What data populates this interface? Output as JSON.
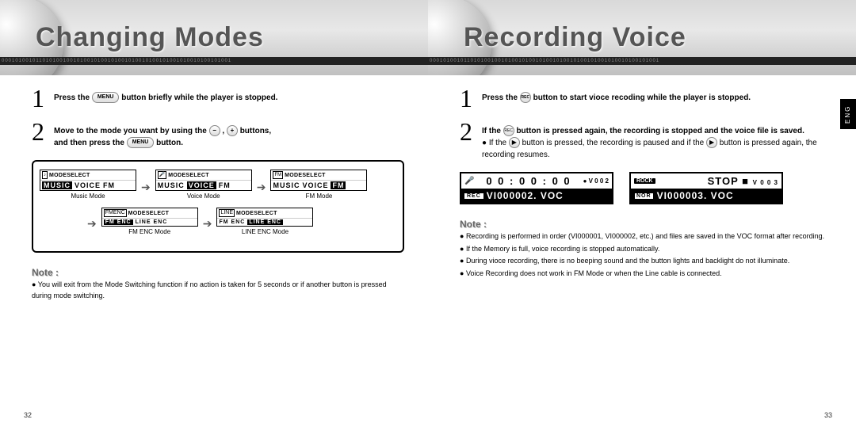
{
  "left": {
    "title": "Changing Modes",
    "binary": "0001010010110101001001010010100101001010010100101001010010100101001",
    "step1": {
      "text_a": "Press the",
      "btn": "MENU",
      "text_b": "button briefly while the player is stopped."
    },
    "step2": {
      "text_a": "Move to the mode you want by using the",
      "minus": "−",
      "plus": "+",
      "text_b": "buttons,",
      "text_c": "and then press the",
      "btn": "MENU",
      "text_d": "button."
    },
    "modeselect": "MODESELECT",
    "modes": {
      "music": {
        "opts": [
          "MUSIC",
          "VOICE",
          "FM"
        ],
        "sel": 0,
        "caption": "Music Mode",
        "icon": "♪"
      },
      "voice": {
        "opts": [
          "MUSIC",
          "VOICE",
          "FM"
        ],
        "sel": 1,
        "caption": "Voice Mode",
        "icon": "🎤"
      },
      "fm": {
        "opts": [
          "MUSIC",
          "VOICE",
          "FM"
        ],
        "sel": 2,
        "caption": "FM Mode",
        "icon": "FM"
      },
      "fmenc": {
        "opts": [
          "FM ENC",
          "LINE ENC"
        ],
        "sel": 0,
        "caption": "FM ENC Mode",
        "icon": "FMENC"
      },
      "lineenc": {
        "opts": [
          "FM ENC",
          "LINE ENC"
        ],
        "sel": 1,
        "caption": "LINE ENC Mode",
        "icon": "LINE"
      }
    },
    "note_label": "Note :",
    "note_text": "You will exit from the Mode Switching function if no action is taken for 5 seconds or if another button is pressed during mode switching.",
    "page_num": "32"
  },
  "right": {
    "title": "Recording Voice",
    "eng": "ENG",
    "step1": {
      "text_a": "Press the",
      "btn": "REC",
      "text_b": "button to start vioce recoding while the player is stopped."
    },
    "step2": {
      "text_a": "If the",
      "btn": "REC",
      "text_b": "button is pressed again, the recording is stopped and the voice file is saved.",
      "sub_a": "If the",
      "sub_btn": "▶",
      "sub_b": "button is pressed, the recording is paused and if the",
      "sub_btn2": "▶",
      "sub_c": "button is pressed again, the recording resumes."
    },
    "lcd1": {
      "time": "0 0 : 0 0 : 0 0",
      "track": "V  0 0 2",
      "rec": "REC",
      "file": "VI000002. VOC"
    },
    "lcd2": {
      "rock": "ROCK",
      "stop": "STOP",
      "track": "V  0 0 3",
      "nor": "NOR",
      "file": "VI000003. VOC"
    },
    "note_label": "Note :",
    "notes": [
      "Recording is performed in order (VI000001, VI000002, etc.) and files are saved in the VOC format after recording.",
      "If the Memory is full, voice recording is stopped automatically.",
      "During vioce recording, there is no beeping sound and the button lights and backlight do not illuminate.",
      "Voice Recording does not work in FM Mode or when the Line cable is connected."
    ],
    "page_num": "33"
  }
}
